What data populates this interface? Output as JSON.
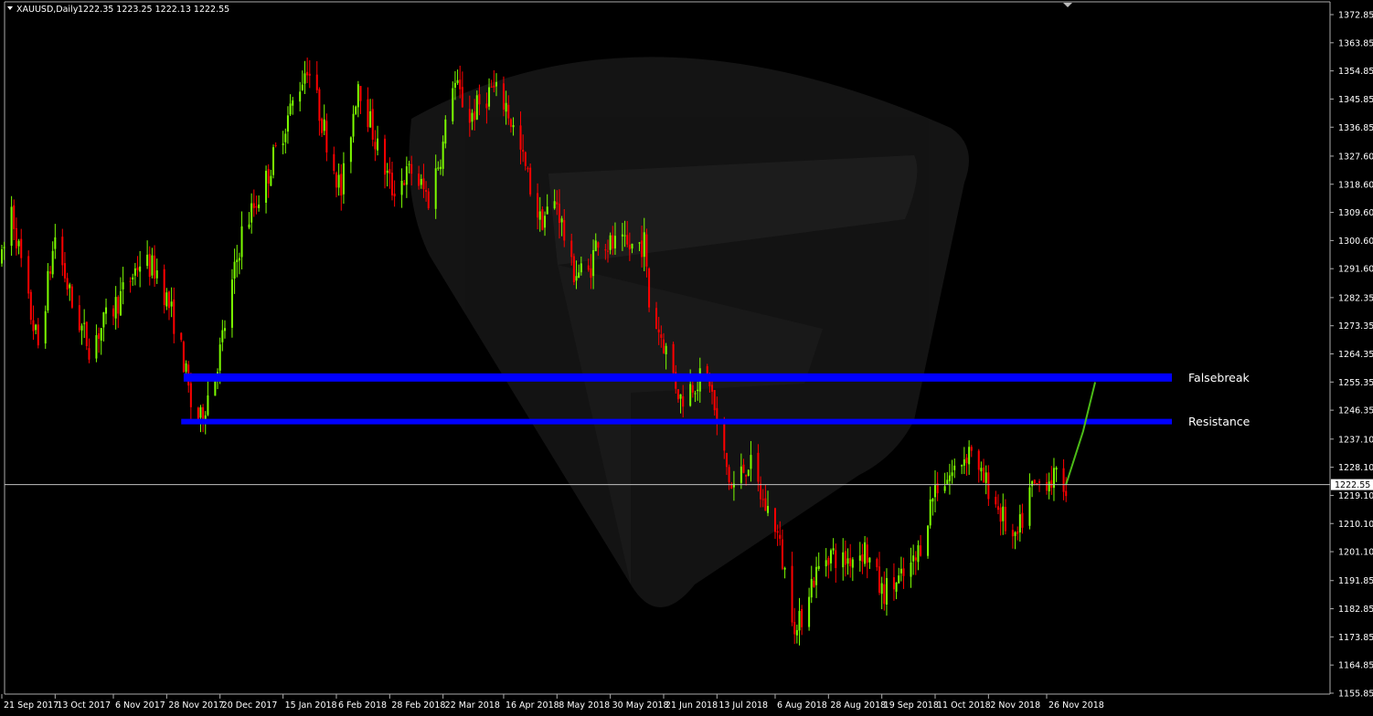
{
  "header": {
    "collapse_icon": "triangle-down-icon",
    "symbol": "XAUUSD,Daily",
    "ohlc": "1222.35 1223.25 1222.13 1222.55"
  },
  "colors": {
    "background": "#000000",
    "bull_candle": "#7CFC00",
    "bear_candle": "#FF0000",
    "level_line": "#0000FF",
    "projection": "#4CBB17",
    "axis": "#FFFFFF",
    "watermark": "#1A1A1A"
  },
  "chart_data": {
    "type": "candlestick",
    "title": "XAUUSD,Daily",
    "x_ticks": [
      "21 Sep 2017",
      "13 Oct 2017",
      "6 Nov 2017",
      "28 Nov 2017",
      "20 Dec 2017",
      "15 Jan 2018",
      "6 Feb 2018",
      "28 Feb 2018",
      "22 Mar 2018",
      "16 Apr 2018",
      "8 May 2018",
      "30 May 2018",
      "21 Jun 2018",
      "13 Jul 2018",
      "6 Aug 2018",
      "28 Aug 2018",
      "19 Sep 2018",
      "11 Oct 2018",
      "2 Nov 2018",
      "26 Nov 2018"
    ],
    "y_ticks": [
      "1372.85",
      "1363.85",
      "1354.85",
      "1345.85",
      "1336.85",
      "1327.60",
      "1318.60",
      "1309.60",
      "1300.60",
      "1291.60",
      "1282.35",
      "1273.35",
      "1264.35",
      "1255.35",
      "1246.35",
      "1237.10",
      "1228.10",
      "1219.10",
      "1210.10",
      "1201.10",
      "1191.85",
      "1182.85",
      "1173.85",
      "1164.85",
      "1155.85"
    ],
    "ylim": [
      1155.85,
      1375.8
    ],
    "current_price": "1222.55",
    "grid": false,
    "levels": [
      {
        "name": "Falsebreak",
        "price": 1256.8,
        "x_start": "5 Dec 2017"
      },
      {
        "name": "Resistance",
        "price": 1242.7,
        "x_start": "4 Dec 2017"
      }
    ],
    "projection": [
      {
        "date": "4 Dec 2018",
        "price": 1222.6
      },
      {
        "date": "11 Dec 2018",
        "price": 1239.5
      },
      {
        "date": "16 Dec 2018",
        "price": 1255.3
      }
    ],
    "price_path": [
      {
        "date": "21 Sep 2017",
        "price": 1294
      },
      {
        "date": "25 Sep 2017",
        "price": 1311
      },
      {
        "date": "2 Oct 2017",
        "price": 1280
      },
      {
        "date": "6 Oct 2017",
        "price": 1267
      },
      {
        "date": "13 Oct 2017",
        "price": 1302
      },
      {
        "date": "20 Oct 2017",
        "price": 1280
      },
      {
        "date": "27 Oct 2017",
        "price": 1267
      },
      {
        "date": "3 Nov 2017",
        "price": 1275
      },
      {
        "date": "10 Nov 2017",
        "price": 1284
      },
      {
        "date": "17 Nov 2017",
        "price": 1294
      },
      {
        "date": "24 Nov 2017",
        "price": 1291
      },
      {
        "date": "28 Nov 2017",
        "price": 1282
      },
      {
        "date": "1 Dec 2017",
        "price": 1275
      },
      {
        "date": "5 Dec 2017",
        "price": 1262
      },
      {
        "date": "8 Dec 2017",
        "price": 1248
      },
      {
        "date": "12 Dec 2017",
        "price": 1243
      },
      {
        "date": "20 Dec 2017",
        "price": 1265
      },
      {
        "date": "29 Dec 2017",
        "price": 1303
      },
      {
        "date": "8 Jan 2018",
        "price": 1320
      },
      {
        "date": "15 Jan 2018",
        "price": 1336
      },
      {
        "date": "25 Jan 2018",
        "price": 1357
      },
      {
        "date": "2 Feb 2018",
        "price": 1333
      },
      {
        "date": "8 Feb 2018",
        "price": 1316
      },
      {
        "date": "15 Feb 2018",
        "price": 1352
      },
      {
        "date": "23 Feb 2018",
        "price": 1330
      },
      {
        "date": "1 Mar 2018",
        "price": 1317
      },
      {
        "date": "9 Mar 2018",
        "price": 1323
      },
      {
        "date": "16 Mar 2018",
        "price": 1314
      },
      {
        "date": "22 Mar 2018",
        "price": 1331
      },
      {
        "date": "26 Mar 2018",
        "price": 1352
      },
      {
        "date": "2 Apr 2018",
        "price": 1340
      },
      {
        "date": "11 Apr 2018",
        "price": 1349
      },
      {
        "date": "17 Apr 2018",
        "price": 1344
      },
      {
        "date": "24 Apr 2018",
        "price": 1326
      },
      {
        "date": "1 May 2018",
        "price": 1307
      },
      {
        "date": "8 May 2018",
        "price": 1313
      },
      {
        "date": "14 May 2018",
        "price": 1291
      },
      {
        "date": "21 May 2018",
        "price": 1290
      },
      {
        "date": "25 May 2018",
        "price": 1302
      },
      {
        "date": "30 May 2018",
        "price": 1299
      },
      {
        "date": "6 Jun 2018",
        "price": 1298
      },
      {
        "date": "13 Jun 2018",
        "price": 1300
      },
      {
        "date": "15 Jun 2018",
        "price": 1280
      },
      {
        "date": "21 Jun 2018",
        "price": 1268
      },
      {
        "date": "28 Jun 2018",
        "price": 1250
      },
      {
        "date": "4 Jul 2018",
        "price": 1256
      },
      {
        "date": "10 Jul 2018",
        "price": 1256
      },
      {
        "date": "13 Jul 2018",
        "price": 1241
      },
      {
        "date": "19 Jul 2018",
        "price": 1221
      },
      {
        "date": "26 Jul 2018",
        "price": 1230
      },
      {
        "date": "1 Aug 2018",
        "price": 1217
      },
      {
        "date": "6 Aug 2018",
        "price": 1210
      },
      {
        "date": "15 Aug 2018",
        "price": 1175
      },
      {
        "date": "20 Aug 2018",
        "price": 1190
      },
      {
        "date": "28 Aug 2018",
        "price": 1201
      },
      {
        "date": "3 Sep 2018",
        "price": 1198
      },
      {
        "date": "12 Sep 2018",
        "price": 1202
      },
      {
        "date": "19 Sep 2018",
        "price": 1188
      },
      {
        "date": "27 Sep 2018",
        "price": 1192
      },
      {
        "date": "3 Oct 2018",
        "price": 1198
      },
      {
        "date": "11 Oct 2018",
        "price": 1222
      },
      {
        "date": "18 Oct 2018",
        "price": 1226
      },
      {
        "date": "26 Oct 2018",
        "price": 1235
      },
      {
        "date": "29 Oct 2018",
        "price": 1225
      },
      {
        "date": "2 Nov 2018",
        "price": 1222
      },
      {
        "date": "13 Nov 2018",
        "price": 1203
      },
      {
        "date": "19 Nov 2018",
        "price": 1220
      },
      {
        "date": "26 Nov 2018",
        "price": 1225
      },
      {
        "date": "4 Dec 2018",
        "price": 1222.55
      }
    ]
  }
}
